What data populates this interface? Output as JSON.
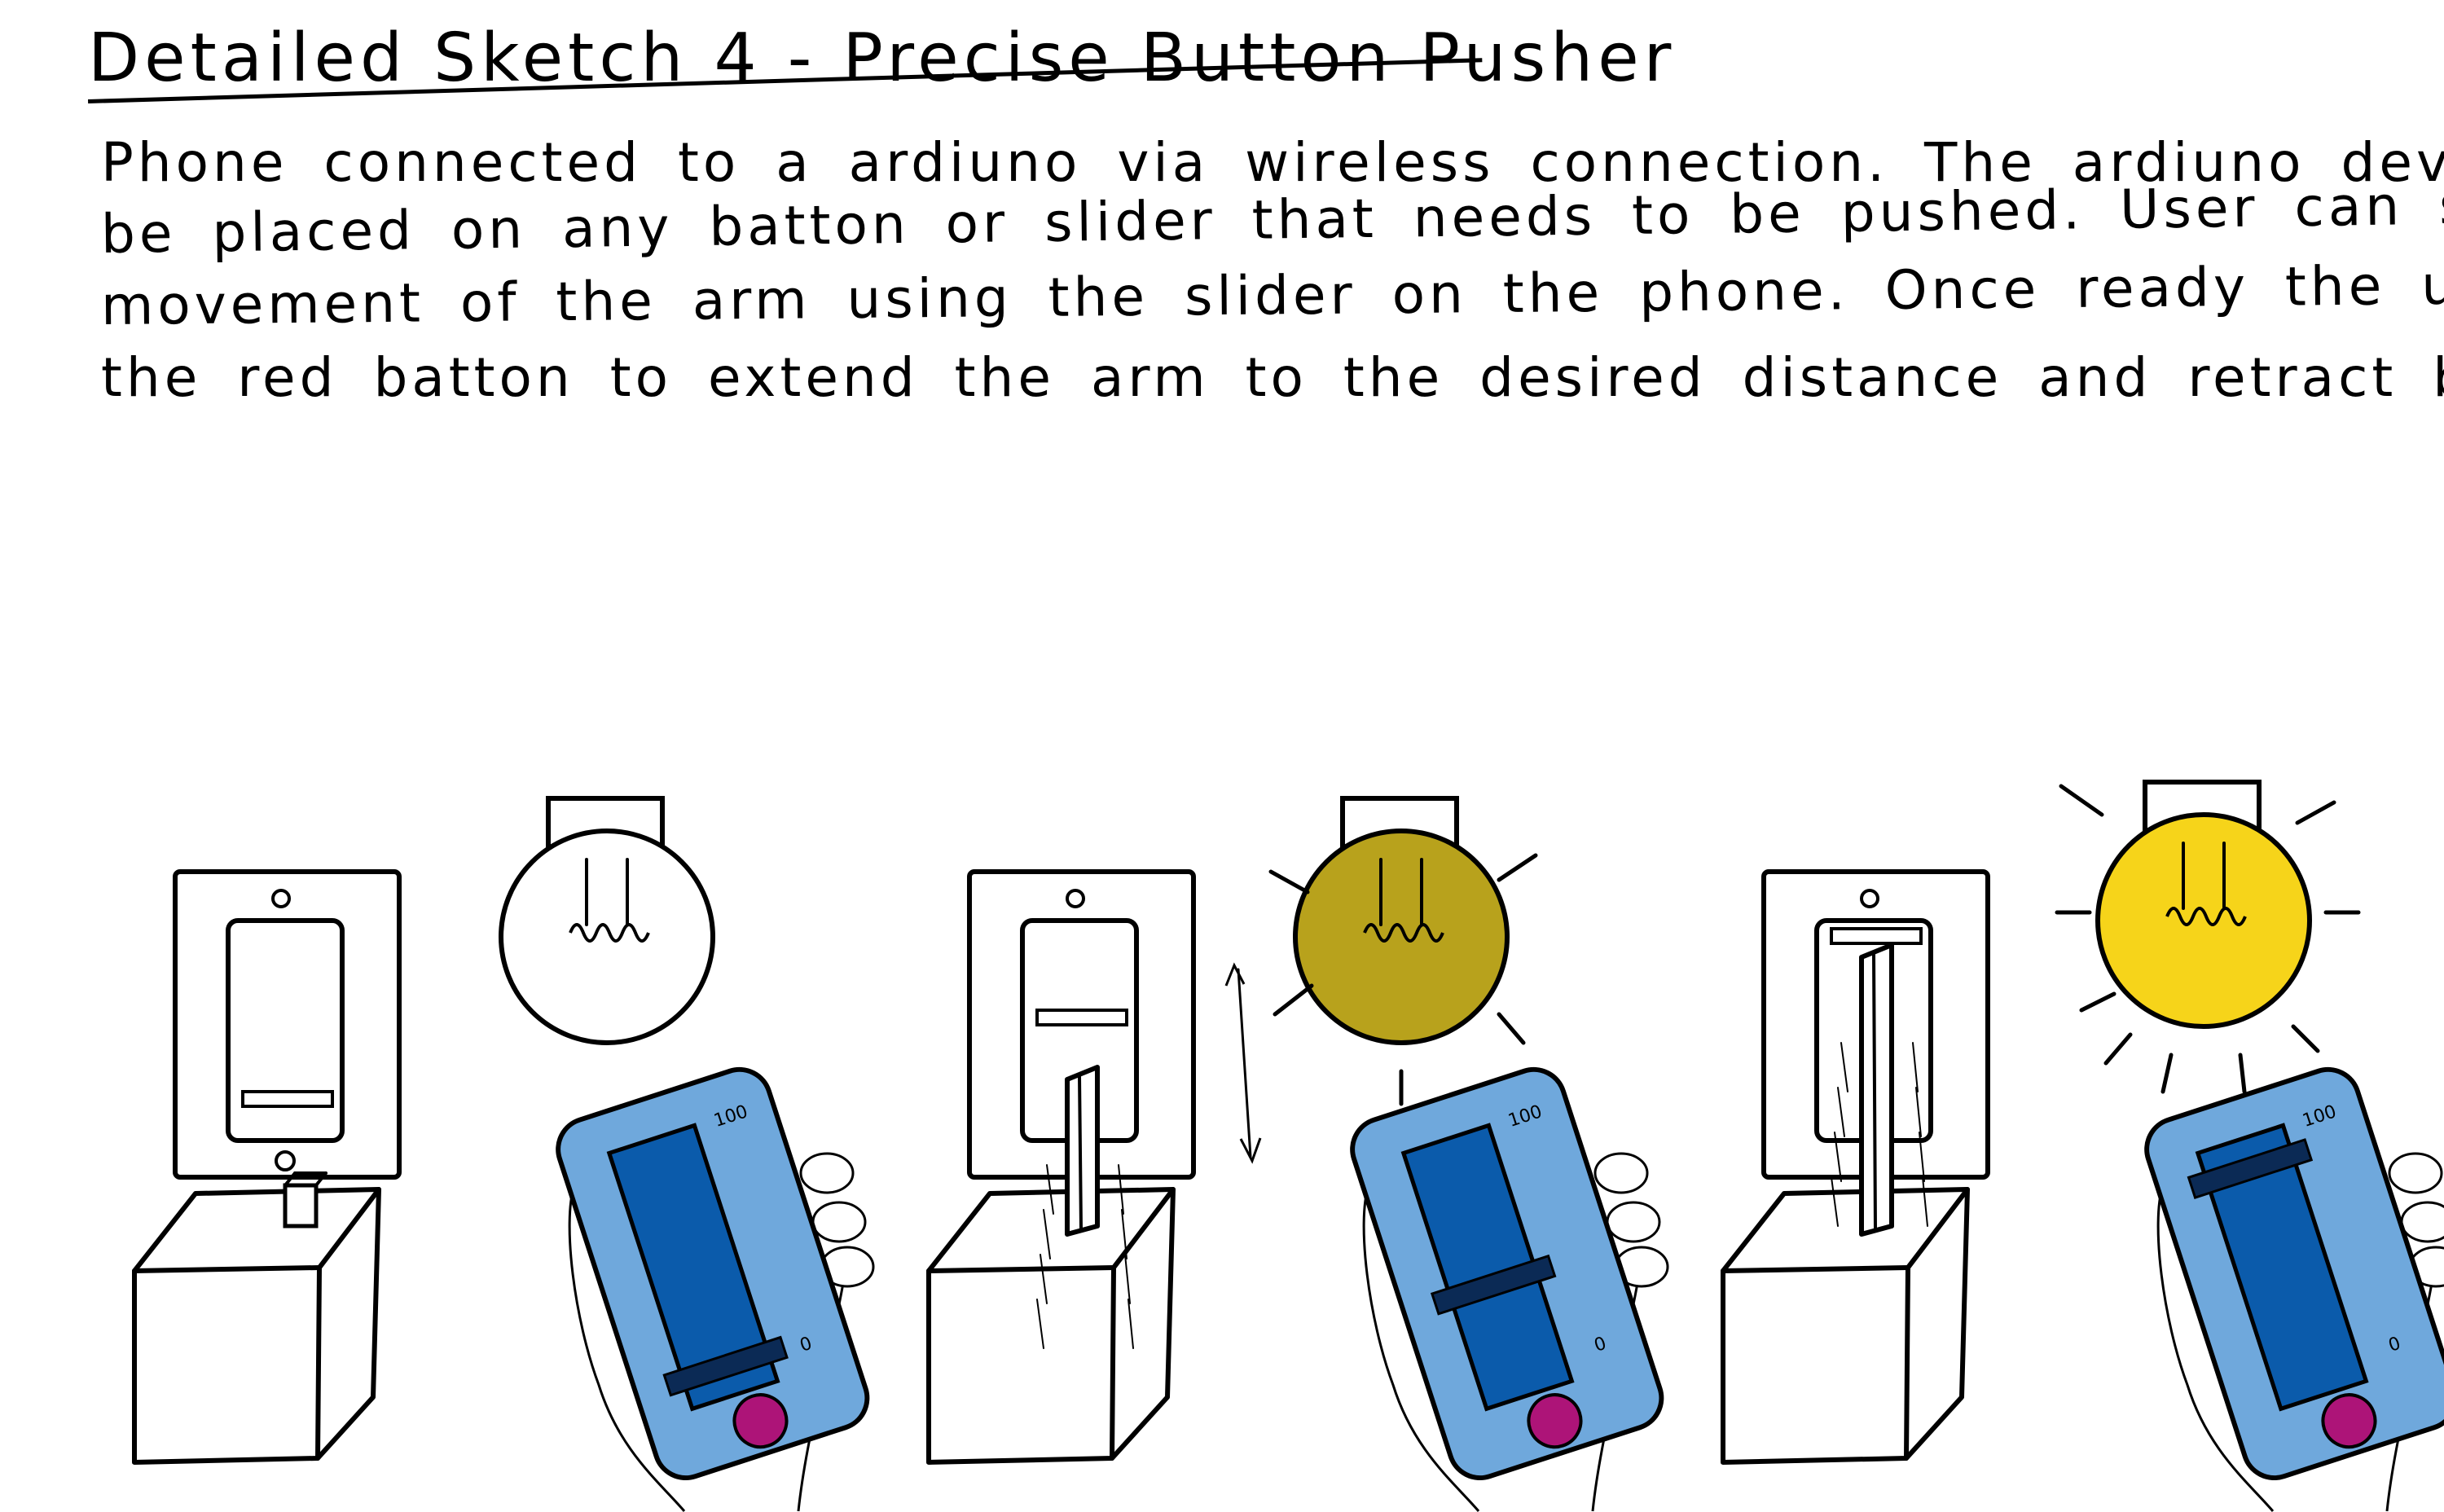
{
  "title": "Detailed Sketch 4 - Precise Button Pusher",
  "description_lines": [
    "Phone connected to a ardiuno via wireless connection. The ardiuno device con",
    "be placed on any batton or slider that needs to be pushed. User can set the distance",
    "movement of the arm using the slider on the phone. Once ready the user presses",
    "the red batton to extend the arm to the desired distance and retract back."
  ],
  "phone_slider_max_label": "100",
  "phone_slider_min_label": "0",
  "states": [
    {
      "bulb_color": "#ffffff",
      "slider_level": 0.1,
      "arm_extension": 0.0
    },
    {
      "bulb_color": "#b8a21c",
      "slider_level": 0.45,
      "arm_extension": 0.5
    },
    {
      "bulb_color": "#f6d41a",
      "slider_level": 0.95,
      "arm_extension": 1.0
    }
  ],
  "colors": {
    "ink": "#000000",
    "phone_body": "#6fa8dc",
    "phone_screen": "#0b5bab",
    "slider_handle": "#0b2a55",
    "push_button": "#ad1478"
  }
}
